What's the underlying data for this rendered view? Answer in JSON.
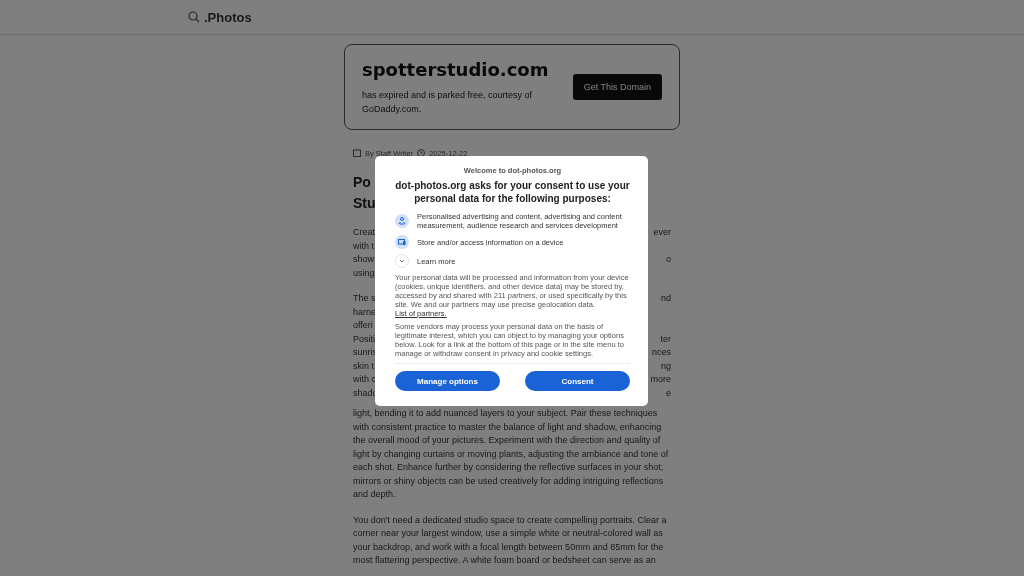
{
  "header": {
    "logo": ".Photos"
  },
  "domain_card": {
    "domain": "spotterstudio.com",
    "message": "has expired and is parked free, courtesy of GoDaddy.com.",
    "button": "Get This Domain"
  },
  "article": {
    "byline": {
      "author": "By Staff Writer",
      "date": "2025-12-22"
    },
    "title_lines": [
      {
        "left": "Po"
      },
      {
        "left": "Stu"
      }
    ],
    "paragraphs": [
      {
        "clipped_lines": [
          {
            "left": "Creat",
            "right": "ever"
          },
          {
            "left": "with t"
          },
          {
            "left": "show",
            "right": "o"
          },
          {
            "left": "using"
          }
        ]
      },
      {
        "clipped_lines": [
          {
            "left": "The s",
            "right": "nd"
          },
          {
            "left": "harne"
          },
          {
            "left": "offeri"
          },
          {
            "left": "Positi",
            "right": "ter"
          },
          {
            "left": "sunris",
            "right": "nces"
          },
          {
            "left": "skin t",
            "right": "ng"
          },
          {
            "left": "with c",
            "right": "more"
          },
          {
            "left": "shado",
            "right": "e"
          }
        ],
        "text": "light, bending it to add nuanced layers to your subject. Pair these techniques with consistent practice to master the balance of light and shadow, enhancing the overall mood of your pictures. Experiment with the direction and quality of light by changing curtains or moving plants, adjusting the ambiance and tone of each shot. Enhance further by considering the reflective surfaces in your shot; mirrors or shiny objects can be used creatively for adding intriguing reflections and depth."
      },
      {
        "text": "You don't need a dedicated studio space to create compelling portraits. Clear a corner near your largest window, use a simple white or neutral-colored wall as your backdrop, and work with a focal length between 50mm and 85mm for the most flattering perspective. A white foam board or bedsheet can serve as an"
      }
    ]
  },
  "consent": {
    "welcome": "Welcome to dot-photos.org",
    "heading": "dot-photos.org asks for your consent to use your personal data for the following purposes:",
    "purposes": [
      {
        "kind": "people",
        "text": "Personalised advertising and content, advertising and content measurement, audience research and services development"
      },
      {
        "kind": "device",
        "text": "Store and/or access information on a device"
      },
      {
        "kind": "expand",
        "text": "Learn more"
      }
    ],
    "notice": "Your personal data will be processed and information from your device (cookies, unique identifiers, and other device data) may be stored by, accessed by and shared with 211 partners, or used specifically by this site. We and our partners may use precise geolocation data.",
    "notice_link": "List of partners.",
    "vendors": "Some vendors may process your personal data on the basis of legitimate interest, which you can object to by managing your options below. Look for a link at the bottom of this page or in the site menu to manage or withdraw consent in privacy and cookie settings.",
    "buttons": [
      "Manage options",
      "Consent"
    ]
  }
}
